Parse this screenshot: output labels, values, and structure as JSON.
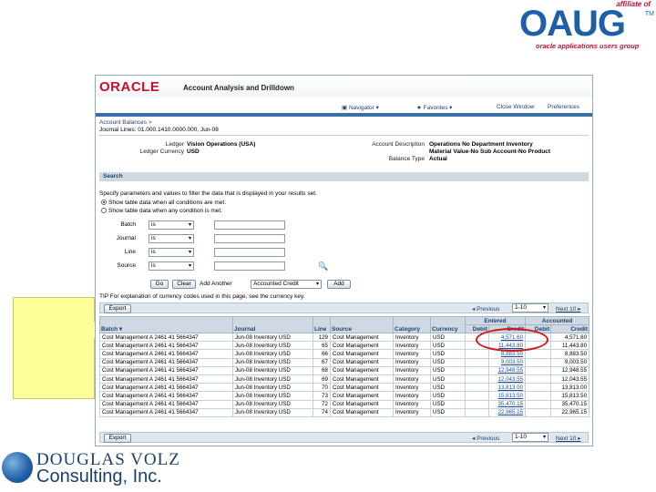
{
  "slide": {
    "oaug": {
      "affiliate": "affiliate of",
      "word": "OAUG",
      "tagline": "oracle applications users group"
    },
    "footer_logo": {
      "line1": "DOUGLAS VOLZ",
      "line2": "Consulting, Inc."
    }
  },
  "app": {
    "brand": "ORACLE",
    "title": "Account Analysis and Drilldown",
    "nav": {
      "navigator": "Navigator",
      "favorites": "Favorites",
      "close_window": "Close Window",
      "preferences": "Preferences"
    },
    "breadcrumb": "Account Balances",
    "subtitle": "Journal Lines: 01.000.1410.0000.000, Jun-08",
    "info": {
      "ledger_label": "Ledger",
      "ledger": "Vision Operations (USA)",
      "currency_label": "Ledger Currency",
      "currency": "USD",
      "acct_desc_label": "Account Description",
      "acct_desc_1": "Operations No Department Inventory",
      "acct_desc_2": "Material Value-No Sub Account-No Product",
      "balance_type_label": "Balance Type",
      "balance_type": "Actual"
    },
    "search": {
      "header": "Search",
      "instructions": "Specify parameters and values to filter the data that is displayed in your results set.",
      "radio_all": "Show table data when all conditions are met.",
      "radio_any": "Show table data when any condition is met.",
      "fields": [
        {
          "label": "Batch",
          "op": "is"
        },
        {
          "label": "Journal",
          "op": "is"
        },
        {
          "label": "Line",
          "op": "is"
        },
        {
          "label": "Source",
          "op": "is"
        }
      ],
      "go": "Go",
      "clear": "Clear",
      "add_another_label": "Add Another",
      "add_another_value": "Accounted Credit",
      "add": "Add"
    },
    "tip": "TIP For explanation of currency codes used in this page, see the currency key.",
    "export": "Export",
    "pager": {
      "previous": "Previous",
      "range": "1-10",
      "next": "Next 10"
    },
    "columns": [
      "Batch",
      "Journal",
      "Line",
      "Source",
      "Category",
      "Currency",
      "Debit",
      "Credit",
      "Debit",
      "Credit"
    ],
    "group_headers": {
      "entered": "Entered",
      "accounted": "Accounted"
    },
    "rows": [
      [
        "Cost Management A 2461 41 5664347",
        "Jun-08 Inventory USD",
        "129",
        "Cost Management",
        "Inventory",
        "USD",
        "",
        "4,571.60",
        "",
        "4,571.60"
      ],
      [
        "Cost Management A 2461 41 5664347",
        "Jun-08 Inventory USD",
        "65",
        "Cost Management",
        "Inventory",
        "USD",
        "",
        "11,443.80",
        "",
        "11,443.80"
      ],
      [
        "Cost Management A 2461 41 5664347",
        "Jun-08 Inventory USD",
        "66",
        "Cost Management",
        "Inventory",
        "USD",
        "",
        "8,883.50",
        "",
        "8,883.50"
      ],
      [
        "Cost Management A 2461 41 5664347",
        "Jun-08 Inventory USD",
        "67",
        "Cost Management",
        "Inventory",
        "USD",
        "",
        "9,003.50",
        "",
        "9,003.50"
      ],
      [
        "Cost Management A 2461 41 5664347",
        "Jun-08 Inventory USD",
        "68",
        "Cost Management",
        "Inventory",
        "USD",
        "",
        "12,948.55",
        "",
        "12,948.55"
      ],
      [
        "Cost Management A 2461 41 5664347",
        "Jun-08 Inventory USD",
        "69",
        "Cost Management",
        "Inventory",
        "USD",
        "",
        "12,043.55",
        "",
        "12,043.55"
      ],
      [
        "Cost Management A 2461 41 5664347",
        "Jun-08 Inventory USD",
        "70",
        "Cost Management",
        "Inventory",
        "USD",
        "",
        "13,813.00",
        "",
        "13,813.00"
      ],
      [
        "Cost Management A 2461 41 5664347",
        "Jun-08 Inventory USD",
        "73",
        "Cost Management",
        "Inventory",
        "USD",
        "",
        "15,813.50",
        "",
        "15,813.50"
      ],
      [
        "Cost Management A 2461 41 5664347",
        "Jun-08 Inventory USD",
        "72",
        "Cost Management",
        "Inventory",
        "USD",
        "",
        "35,470.15",
        "",
        "35,470.15"
      ],
      [
        "Cost Management A 2461 41 5664347",
        "Jun-08 Inventory USD",
        "74",
        "Cost Management",
        "Inventory",
        "USD",
        "",
        "22,965.15",
        "",
        "22,965.15"
      ]
    ]
  },
  "colors": {
    "oracle_red": "#c8102e",
    "oaug_blue": "#1f5fa8",
    "callout": "#ffff99",
    "highlight": "#d01818"
  }
}
